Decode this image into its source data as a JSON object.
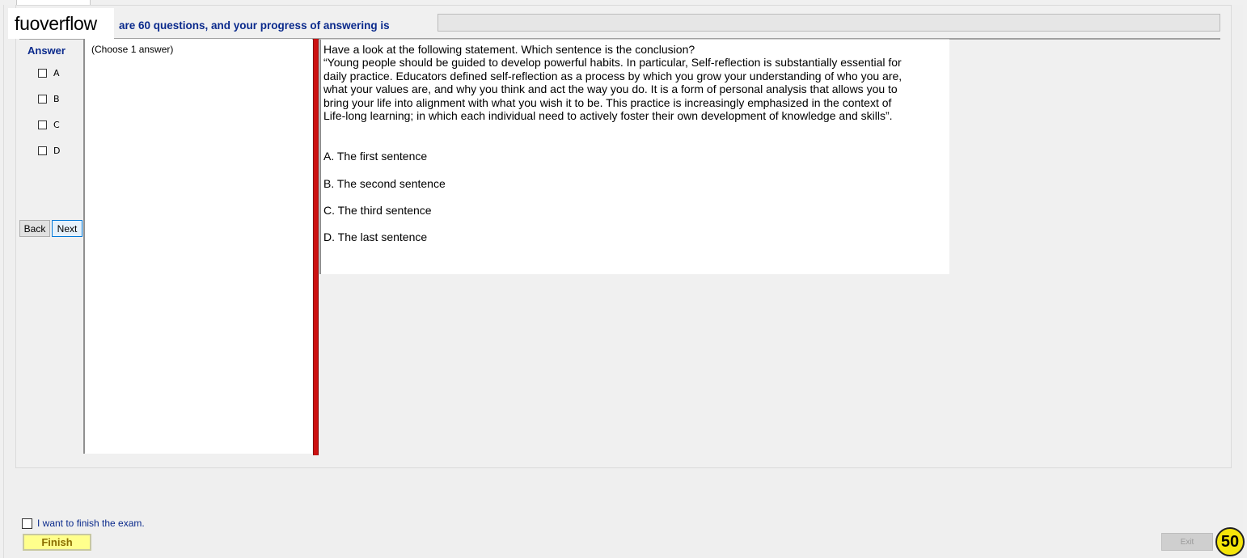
{
  "header": {
    "watermark": "fuoverflow",
    "progress_text": "are 60 questions, and your progress of answering is",
    "progress_fraction": 0
  },
  "answer_panel": {
    "title": "Answer",
    "options": [
      "A",
      "B",
      "C",
      "D"
    ],
    "back_label": "Back",
    "next_label": "Next"
  },
  "choose_panel": {
    "instruction": "(Choose 1 answer)"
  },
  "question": {
    "prompt": "Have a look at the following statement. Which sentence is the conclusion?",
    "passage": "“Young people should be guided to develop powerful habits. In particular, Self-reflection is substantially essential for daily practice. Educators defined self-reflection as a process by which you grow your understanding of who you are, what your values are, and why you think and act the way you do. It is a form of personal analysis that allows you to bring your life into alignment with what you wish it to be. This practice is increasingly emphasized in the context of Life-long learning; in which each individual need to actively foster their own development of knowledge and skills”.",
    "choices": [
      "A.  The first sentence",
      "B.  The second sentence",
      "C.  The third sentence",
      "D.  The last sentence"
    ]
  },
  "footer": {
    "finish_checkbox_label": "I want to finish the exam.",
    "finish_label": "Finish",
    "exit_label": "Exit",
    "timer_value": "50"
  },
  "colors": {
    "accent_blue": "#0a2a8c",
    "splitter_red": "#cc1111",
    "finish_yellow": "#ffff8c",
    "timer_yellow": "#f5e50a"
  }
}
